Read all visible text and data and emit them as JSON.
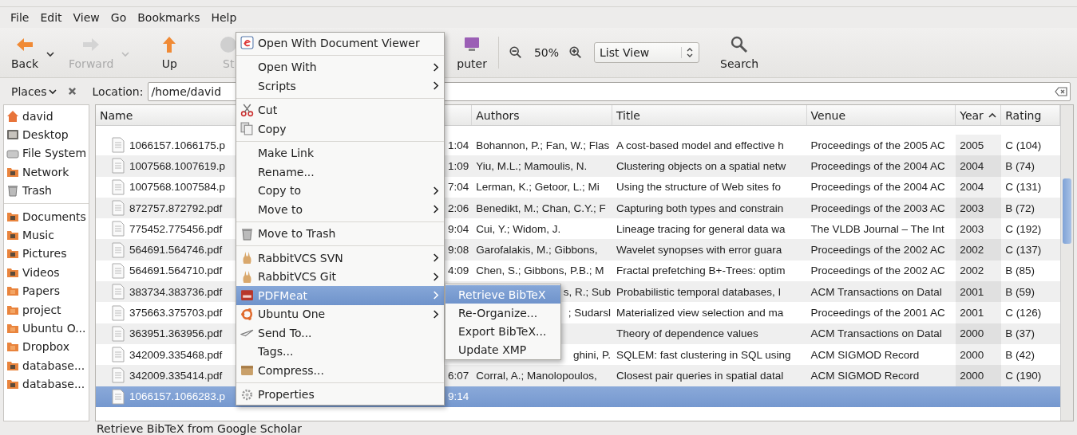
{
  "menubar": [
    "File",
    "Edit",
    "View",
    "Go",
    "Bookmarks",
    "Help"
  ],
  "toolbar": {
    "buttons": [
      {
        "label": "Back",
        "disabled": false,
        "dropdown": true
      },
      {
        "label": "Forward",
        "disabled": true,
        "dropdown": true
      },
      {
        "label": "Up",
        "disabled": false
      },
      {
        "label": "St",
        "disabled": true
      },
      {
        "label": "puter",
        "disabled": false
      }
    ],
    "zoom": "50%",
    "view_select": "List View",
    "search": "Search"
  },
  "location_bar": {
    "places": "Places",
    "label": "Location:",
    "value": "/home/david"
  },
  "sidebar": {
    "groups": [
      [
        {
          "label": "david"
        },
        {
          "label": "Desktop"
        },
        {
          "label": "File System"
        },
        {
          "label": "Network"
        },
        {
          "label": "Trash"
        }
      ],
      [
        {
          "label": "Documents"
        },
        {
          "label": "Music"
        },
        {
          "label": "Pictures"
        },
        {
          "label": "Videos"
        },
        {
          "label": "Papers"
        },
        {
          "label": "project"
        },
        {
          "label": "Ubuntu O..."
        },
        {
          "label": "Dropbox"
        },
        {
          "label": "database..."
        },
        {
          "label": "database..."
        }
      ]
    ]
  },
  "table": {
    "columns": [
      {
        "label": "Name",
        "sorted": false
      },
      {
        "label": "Authors",
        "sorted": false
      },
      {
        "label": "Title",
        "sorted": false
      },
      {
        "label": "Venue",
        "sorted": false
      },
      {
        "label": "Year",
        "sorted": true
      },
      {
        "label": "Rating",
        "sorted": false
      }
    ],
    "rows": [
      {
        "name": "1066157.1066175.p",
        "time": "1:04",
        "authors": "Bohannon, P.; Fan, W.; Flas",
        "title": "A cost-based model and effective h",
        "venue": "Proceedings of the 2005 AC",
        "year": "2005",
        "rating": "C (104)",
        "selected": false
      },
      {
        "name": "1007568.1007619.p",
        "time": "1:09",
        "authors": "Yiu, M.L.; Mamoulis, N.",
        "title": "Clustering objects on a spatial netw",
        "venue": "Proceedings of the 2004 AC",
        "year": "2004",
        "rating": "B (74)",
        "selected": false
      },
      {
        "name": "1007568.1007584.p",
        "time": "7:04",
        "authors": "Lerman, K.; Getoor, L.; Mi",
        "title": "Using the structure of Web sites fo",
        "venue": "Proceedings of the 2004 AC",
        "year": "2004",
        "rating": "C (131)",
        "selected": false
      },
      {
        "name": "872757.872792.pdf",
        "time": "2:06",
        "authors": "Benedikt, M.; Chan, C.Y.; F",
        "title": "Capturing both types and constrain",
        "venue": "Proceedings of the 2003 AC",
        "year": "2003",
        "rating": "B (72)",
        "selected": false
      },
      {
        "name": "775452.775456.pdf",
        "time": "9:04",
        "authors": "Cui, Y.; Widom, J.",
        "title": "Lineage tracing for general data wa",
        "venue": "The VLDB Journal – The Int",
        "year": "2003",
        "rating": "C (192)",
        "selected": false
      },
      {
        "name": "564691.564746.pdf",
        "time": "9:08",
        "authors": "Garofalakis, M.; Gibbons,",
        "title": "Wavelet synopses with error guara",
        "venue": "Proceedings of the 2002 AC",
        "year": "2002",
        "rating": "C (137)",
        "selected": false
      },
      {
        "name": "564691.564710.pdf",
        "time": "4:09",
        "authors": "Chen, S.; Gibbons, P.B.; M",
        "title": "Fractal prefetching B+-Trees: optim",
        "venue": "Proceedings of the 2002 AC",
        "year": "2002",
        "rating": "B (85)",
        "selected": false
      },
      {
        "name": "383734.383736.pdf",
        "authors": "s, R.; Sub",
        "covered": true,
        "title": "Probabilistic temporal databases, I",
        "venue": "ACM Transactions on Datal",
        "year": "2001",
        "rating": "B (59)",
        "selected": false
      },
      {
        "name": "375663.375703.pdf",
        "authors": "; Sudarsl",
        "covered": true,
        "title": "Materialized view selection and ma",
        "venue": "Proceedings of the 2001 AC",
        "year": "2001",
        "rating": "C (126)",
        "selected": false
      },
      {
        "name": "363951.363956.pdf",
        "title": "Theory of dependence values",
        "venue": "ACM Transactions on Datal",
        "year": "2000",
        "rating": "B (37)",
        "selected": false
      },
      {
        "name": "342009.335468.pdf",
        "authors": "ghini, P.",
        "covered": true,
        "title": "SQLEM: fast clustering in SQL using",
        "venue": "ACM SIGMOD Record",
        "year": "2000",
        "rating": "B (42)",
        "selected": false
      },
      {
        "name": "342009.335414.pdf",
        "time": "6:07",
        "authors": "Corral, A.; Manolopoulos,",
        "title": "Closest pair queries in spatial datal",
        "venue": "ACM SIGMOD Record",
        "year": "2000",
        "rating": "C (190)",
        "selected": false
      },
      {
        "name": "1066157.1066283.p",
        "time": "9:14",
        "selected": true
      }
    ]
  },
  "context_menu": {
    "groups": [
      [
        {
          "label": "Open With Document Viewer",
          "submenu": false,
          "selected": false
        }
      ],
      [
        {
          "label": "Open With",
          "submenu": true,
          "selected": false
        },
        {
          "label": "Scripts",
          "submenu": true,
          "selected": false
        }
      ],
      [
        {
          "label": "Cut",
          "submenu": false,
          "selected": false
        },
        {
          "label": "Copy",
          "submenu": false,
          "selected": false
        }
      ],
      [
        {
          "label": "Make Link",
          "submenu": false,
          "selected": false
        },
        {
          "label": "Rename...",
          "submenu": false,
          "selected": false
        },
        {
          "label": "Copy to",
          "submenu": true,
          "selected": false
        },
        {
          "label": "Move to",
          "submenu": true,
          "selected": false
        }
      ],
      [
        {
          "label": "Move to Trash",
          "submenu": false,
          "selected": false
        }
      ],
      [
        {
          "label": "RabbitVCS SVN",
          "submenu": true,
          "selected": false
        },
        {
          "label": "RabbitVCS Git",
          "submenu": true,
          "selected": false
        },
        {
          "label": "PDFMeat",
          "submenu": true,
          "selected": true
        },
        {
          "label": "Ubuntu One",
          "submenu": true,
          "selected": false
        },
        {
          "label": "Send To...",
          "submenu": false,
          "selected": false
        },
        {
          "label": "Tags...",
          "submenu": false,
          "selected": false
        },
        {
          "label": "Compress...",
          "submenu": false,
          "selected": false
        }
      ],
      [
        {
          "label": "Properties",
          "submenu": false,
          "selected": false
        }
      ]
    ]
  },
  "submenu": [
    {
      "label": "Retrieve BibTeX",
      "selected": true
    },
    {
      "label": "Re-Organize...",
      "selected": false
    },
    {
      "label": "Export BibTeX...",
      "selected": false
    },
    {
      "label": "Update XMP",
      "selected": false
    }
  ],
  "status_bar": "Retrieve BibTeX from Google Scholar"
}
